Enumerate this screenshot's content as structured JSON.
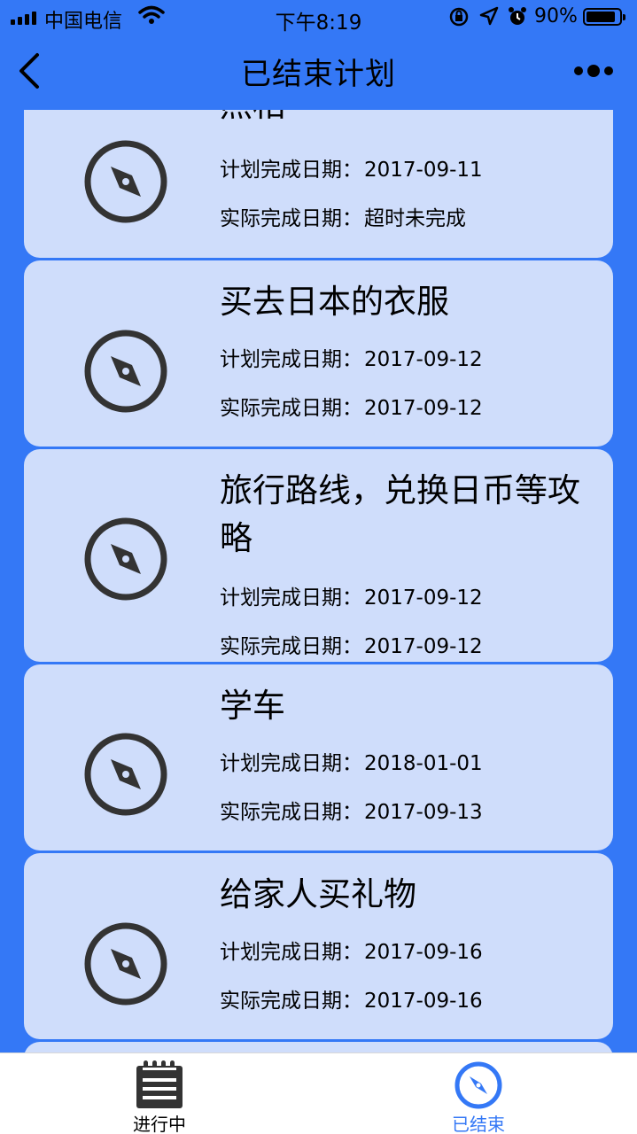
{
  "status_bar": {
    "carrier": "中国电信",
    "time": "下午8:19",
    "battery": "90%",
    "battery_level": 0.9,
    "icons": [
      "signal-icon",
      "wifi-icon",
      "rotation-lock-icon",
      "location-icon",
      "alarm-icon",
      "battery-icon"
    ]
  },
  "nav": {
    "title": "已结束计划",
    "back_icon": "chevron-left-icon",
    "more_icon": "more-dots-icon"
  },
  "colors": {
    "primary": "#3478f6",
    "card": "#cfddfb",
    "icon_dark": "#333333"
  },
  "plans": [
    {
      "title": "照相",
      "planned_label": "计划完成日期：",
      "planned": "2017-09-11",
      "actual_label": "实际完成日期：",
      "actual": "超时未完成",
      "icon": "compass-icon"
    },
    {
      "title": "买去日本的衣服",
      "planned_label": "计划完成日期：",
      "planned": "2017-09-12",
      "actual_label": "实际完成日期：",
      "actual": "2017-09-12",
      "icon": "compass-icon"
    },
    {
      "title": "旅行路线，兑换日币等攻略",
      "planned_label": "计划完成日期：",
      "planned": "2017-09-12",
      "actual_label": "实际完成日期：",
      "actual": "2017-09-12",
      "icon": "compass-icon"
    },
    {
      "title": "学车",
      "planned_label": "计划完成日期：",
      "planned": "2018-01-01",
      "actual_label": "实际完成日期：",
      "actual": "2017-09-13",
      "icon": "compass-icon"
    },
    {
      "title": "给家人买礼物",
      "planned_label": "计划完成日期：",
      "planned": "2017-09-16",
      "actual_label": "实际完成日期：",
      "actual": "2017-09-16",
      "icon": "compass-icon"
    }
  ],
  "tabs": [
    {
      "label": "进行中",
      "icon": "notepad-icon",
      "active": false
    },
    {
      "label": "已结束",
      "icon": "compass-icon",
      "active": true
    }
  ]
}
